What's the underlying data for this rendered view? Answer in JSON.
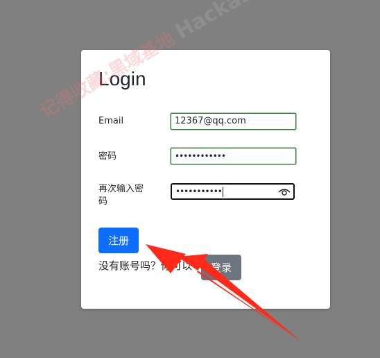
{
  "login": {
    "title": "Login",
    "email_label": "Email",
    "email_value": "12367@qq.com",
    "password_label": "密码",
    "password_value": "••••••••••••",
    "confirm_label": "再次输入密码",
    "confirm_value": "•••••••••••",
    "register_label": "注册",
    "no_account_text": "没有账号吗？你可以",
    "login_label": "登录"
  },
  "overlay": {
    "watermark_text": "记得收藏:黑域基地",
    "watermark_domain": "Hackase.com"
  },
  "colors": {
    "primary": "#0d6efd",
    "secondary": "#6c757d",
    "valid_border": "#2e7d32",
    "arrow": "#ff2a1a",
    "backdrop": "#808080"
  },
  "icons": {
    "eye": "eye-icon",
    "arrow": "arrow-annotation"
  }
}
